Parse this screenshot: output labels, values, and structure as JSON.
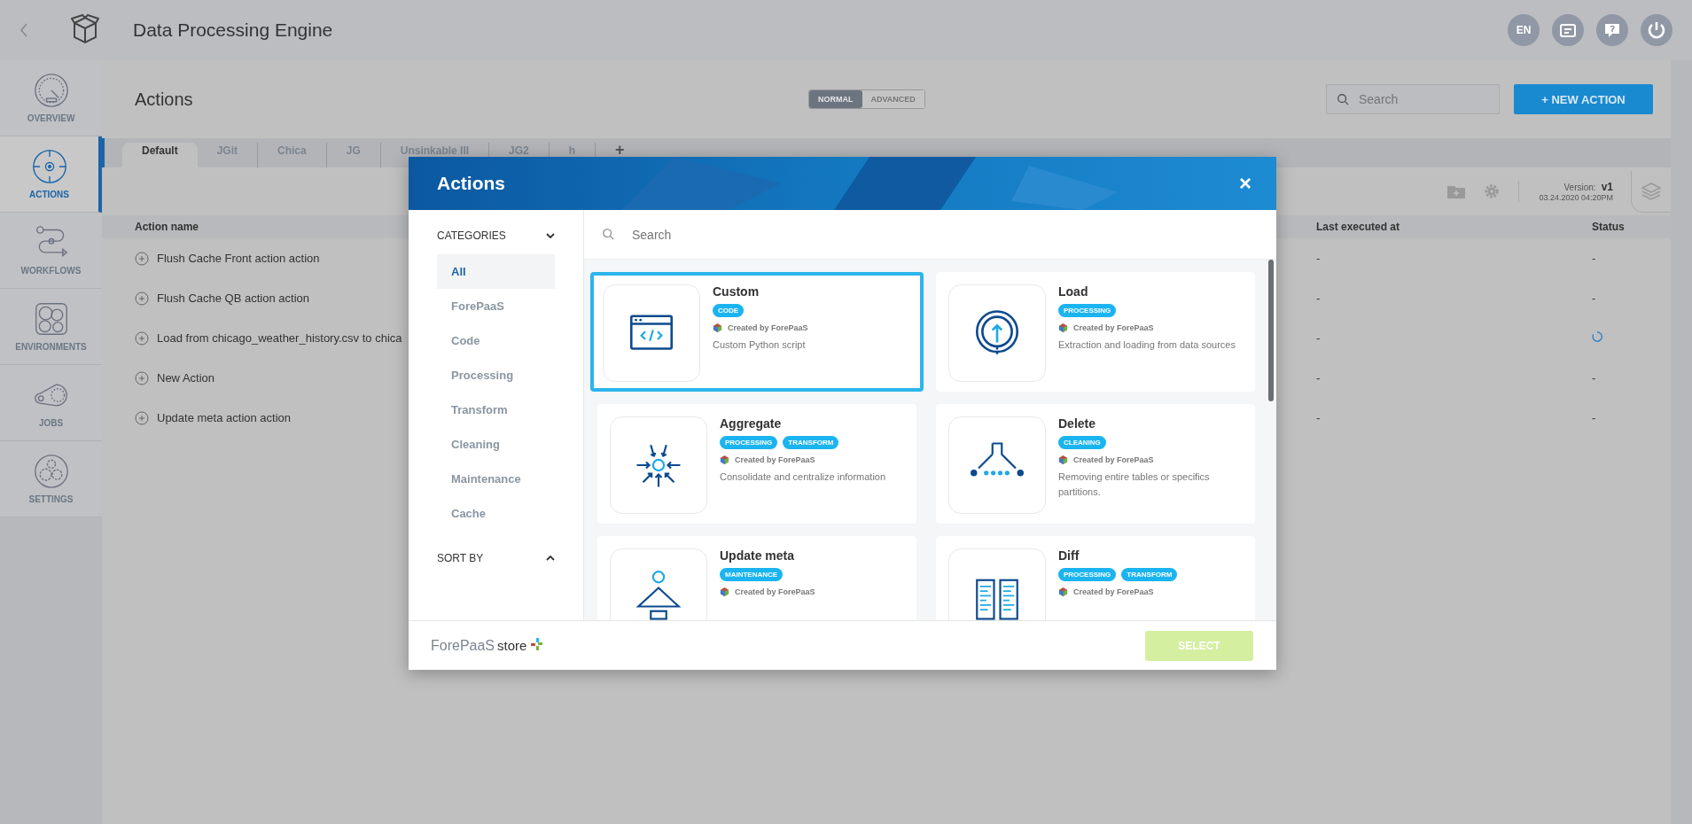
{
  "app": {
    "title": "Data Processing Engine",
    "language": "EN"
  },
  "sidebar": {
    "items": [
      {
        "label": "OVERVIEW",
        "kind": "gauge",
        "selected": false
      },
      {
        "label": "ACTIONS",
        "kind": "target",
        "selected": true
      },
      {
        "label": "WORKFLOWS",
        "kind": "flow",
        "selected": false
      },
      {
        "label": "ENVIRONMENTS",
        "kind": "cells",
        "selected": false
      },
      {
        "label": "JOBS",
        "kind": "belt",
        "selected": false
      },
      {
        "label": "SETTINGS",
        "kind": "gears",
        "selected": false
      }
    ]
  },
  "page": {
    "title": "Actions",
    "modes": [
      {
        "label": "NORMAL",
        "selected": true
      },
      {
        "label": "ADVANCED",
        "selected": false
      }
    ],
    "search": {
      "placeholder": "Search"
    },
    "new_button": "+ NEW ACTION",
    "tabs": [
      {
        "label": "Default",
        "selected": true
      },
      {
        "label": "JGit",
        "selected": false
      },
      {
        "label": "Chica",
        "selected": false
      },
      {
        "label": "JG",
        "selected": false
      },
      {
        "label": "Unsinkable III",
        "selected": false
      },
      {
        "label": "JG2",
        "selected": false
      },
      {
        "label": "h",
        "selected": false
      }
    ],
    "add_tab": "+",
    "version": {
      "label": "Version:",
      "value": "v1",
      "date": "03.24.2020 04:20PM"
    }
  },
  "table": {
    "columns": [
      "Action name",
      "Last executed at",
      "Status"
    ],
    "rows": [
      {
        "name": "Flush Cache Front action action",
        "last": "-",
        "status": "-",
        "kind": "done"
      },
      {
        "name": "Flush Cache QB action action",
        "last": "-",
        "status": "-",
        "kind": "done"
      },
      {
        "name": "Load from chicago_weather_history.csv to chica",
        "last": "-",
        "status": "",
        "kind": "loading"
      },
      {
        "name": "New Action",
        "last": "-",
        "status": "-",
        "kind": "done"
      },
      {
        "name": "Update meta action action",
        "last": "-",
        "status": "-",
        "kind": "done"
      }
    ]
  },
  "modal": {
    "title": "Actions",
    "close": "×",
    "categories_label": "CATEGORIES",
    "sort_label": "SORT BY",
    "categories": [
      {
        "label": "All",
        "selected": true
      },
      {
        "label": "ForePaaS",
        "selected": false
      },
      {
        "label": "Code",
        "selected": false
      },
      {
        "label": "Processing",
        "selected": false
      },
      {
        "label": "Transform",
        "selected": false
      },
      {
        "label": "Cleaning",
        "selected": false
      },
      {
        "label": "Maintenance",
        "selected": false
      },
      {
        "label": "Cache",
        "selected": false
      }
    ],
    "search": {
      "placeholder": "Search"
    },
    "cards": [
      {
        "title": "Custom",
        "kind": "code",
        "tags": [
          "CODE"
        ],
        "creator": "Created by ForePaaS",
        "description": "Custom Python script",
        "selected": true
      },
      {
        "title": "Load",
        "kind": "load",
        "tags": [
          "PROCESSING"
        ],
        "creator": "Created by ForePaaS",
        "description": "Extraction and loading from data sources",
        "selected": false
      },
      {
        "title": "Aggregate",
        "kind": "aggregate",
        "tags": [
          "PROCESSING",
          "TRANSFORM"
        ],
        "creator": "Created by ForePaaS",
        "description": "Consolidate and centralize information",
        "selected": false
      },
      {
        "title": "Delete",
        "kind": "delete",
        "tags": [
          "CLEANING"
        ],
        "creator": "Created by ForePaaS",
        "description": "Removing entire tables or specifics partitions.",
        "selected": false
      },
      {
        "title": "Update meta",
        "kind": "meta",
        "tags": [
          "MAINTENANCE"
        ],
        "creator": "Created by ForePaaS",
        "selected": false
      },
      {
        "title": "Diff",
        "kind": "diff",
        "tags": [
          "PROCESSING",
          "TRANSFORM"
        ],
        "creator": "Created by ForePaaS",
        "selected": false
      }
    ],
    "store_brand": "ForePaaS",
    "store_word": "store",
    "select_button": "SELECT"
  }
}
